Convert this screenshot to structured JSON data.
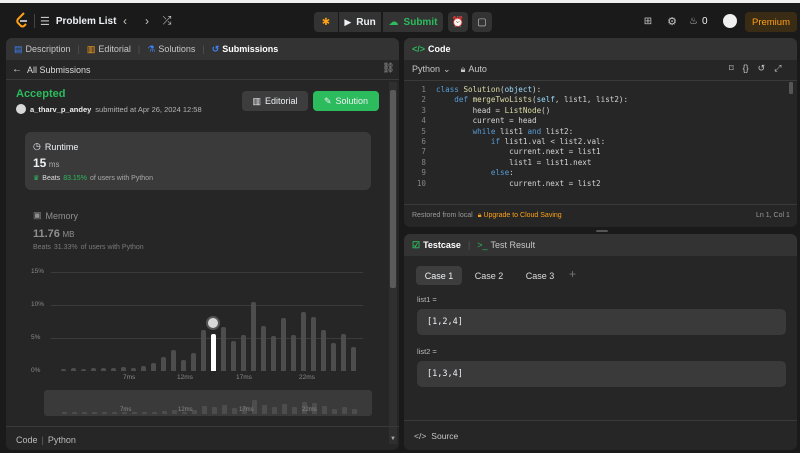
{
  "topbar": {
    "problem_list": "Problem List",
    "run": "Run",
    "submit": "Submit",
    "streak": "0",
    "premium": "Premium"
  },
  "left": {
    "tabs": [
      "Description",
      "Editorial",
      "Solutions",
      "Submissions"
    ],
    "all_submissions": "All Submissions",
    "status": "Accepted",
    "user": "a_tharv_p_andey",
    "submitted_at": "submitted at Apr 26, 2024 12:58",
    "editorial_btn": "Editorial",
    "solution_btn": "Solution",
    "runtime": {
      "label": "Runtime",
      "value": "15",
      "unit": "ms",
      "beats_prefix": "Beats",
      "beats_pct": "83.15%",
      "beats_suffix": "of users with Python"
    },
    "memory": {
      "label": "Memory",
      "value": "11.76",
      "unit": "MB",
      "beats_prefix": "Beats",
      "beats_pct": "31.33%",
      "beats_suffix": "of users with Python"
    },
    "footer": {
      "code": "Code",
      "lang": "Python"
    }
  },
  "chart_data": {
    "type": "bar",
    "y_ticks": [
      "15%",
      "10%",
      "5%",
      "0%"
    ],
    "ylim": [
      0,
      15
    ],
    "x_ticks": [
      "7ms",
      "12ms",
      "17ms",
      "22ms"
    ],
    "values": [
      0.3,
      0.4,
      0.3,
      0.4,
      0.5,
      0.4,
      0.6,
      0.5,
      0.8,
      1.2,
      2.1,
      3.2,
      1.6,
      2.8,
      6.2,
      5.6,
      6.7,
      4.6,
      5.5,
      10.5,
      6.8,
      5.3,
      8.0,
      5.5,
      9.0,
      8.2,
      6.2,
      4.2,
      5.6,
      3.6
    ],
    "highlight_index": 15,
    "mini_values": [
      0.3,
      0.4,
      0.3,
      0.4,
      0.5,
      0.4,
      0.6,
      0.5,
      0.8,
      1.2,
      2.1,
      3.2,
      1.6,
      2.8,
      6.2,
      5.6,
      6.7,
      4.6,
      5.5,
      10.5,
      6.8,
      5.3,
      8.0,
      5.5,
      9.0,
      8.2,
      6.2,
      4.2,
      5.6,
      3.6
    ]
  },
  "code": {
    "title": "Code",
    "language": "Python",
    "mode": "Auto",
    "lines": [
      {
        "n": "1",
        "t": "class Solution(object):"
      },
      {
        "n": "2",
        "t": "    def mergeTwoLists(self, list1, list2):"
      },
      {
        "n": "3",
        "t": "        head = ListNode()"
      },
      {
        "n": "4",
        "t": "        current = head"
      },
      {
        "n": "5",
        "t": "        while list1 and list2:"
      },
      {
        "n": "6",
        "t": "            if list1.val < list2.val:"
      },
      {
        "n": "7",
        "t": "                current.next = list1"
      },
      {
        "n": "8",
        "t": "                list1 = list1.next"
      },
      {
        "n": "9",
        "t": "            else:"
      },
      {
        "n": "10",
        "t": "                current.next = list2"
      }
    ],
    "restored": "Restored from local",
    "upgrade": "Upgrade to Cloud Saving",
    "position": "Ln 1, Col 1"
  },
  "testcase": {
    "tab_testcase": "Testcase",
    "tab_result": "Test Result",
    "cases": [
      "Case 1",
      "Case 2",
      "Case 3"
    ],
    "add": "+",
    "var1_label": "list1 =",
    "var1_value": "[1,2,4]",
    "var2_label": "list2 =",
    "var2_value": "[1,3,4]",
    "source": "Source"
  },
  "colors": {
    "accent_green": "#2cbb5d",
    "accepted": "#2cbb5d",
    "premium": "#ffa116",
    "keyword": "#569cd6"
  }
}
